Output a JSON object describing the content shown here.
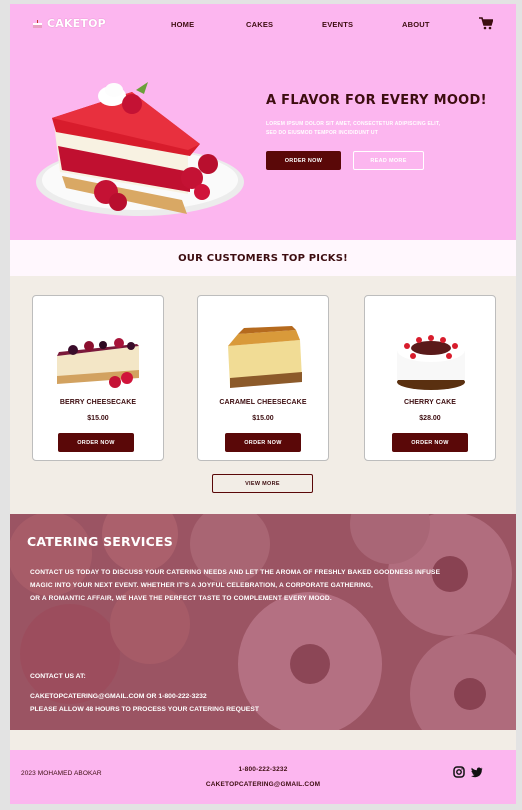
{
  "brand": {
    "name": "CAKETOP"
  },
  "nav": {
    "links": [
      "HOME",
      "CAKES",
      "EVENTS",
      "ABOUT"
    ],
    "cart_icon": "cart-icon"
  },
  "hero": {
    "title": "A FLAVOR FOR EVERY MOOD!",
    "text": "LOREM IPSUM DOLOR SIT AMET, CONSECTETUR ADIPISCING ELIT, SED DO EIUSMOD TEMPOR INCIDIDUNT UT",
    "order_label": "ORDER NOW",
    "read_more_label": "READ MORE"
  },
  "picks": {
    "title": "OUR CUSTOMERS TOP PICKS!",
    "items": [
      {
        "name": "BERRY CHEESECAKE",
        "price": "$15.00",
        "button": "ORDER NOW"
      },
      {
        "name": "CARAMEL CHEESECAKE",
        "price": "$15.00",
        "button": "ORDER NOW"
      },
      {
        "name": "CHERRY CAKE",
        "price": "$28.00",
        "button": "ORDER NOW"
      }
    ],
    "view_more_label": "VIEW MORE"
  },
  "catering": {
    "title": "CATERING SERVICES",
    "lines": [
      "CONTACT US TODAY TO DISCUSS YOUR CATERING NEEDS AND LET THE AROMA OF FRESHLY BAKED GOODNESS INFUSE",
      "MAGIC INTO YOUR NEXT EVENT. WHETHER IT'S A JOYFUL CELEBRATION, A CORPORATE GATHERING,",
      "OR A ROMANTIC AFFAIR, WE HAVE THE PERFECT TASTE TO COMPLEMENT EVERY MOOD."
    ],
    "contact_label": "CONTACT US AT:",
    "contact_line": "CAKETOPCATERING@GMAIL.COM OR 1-800-222-3232",
    "notice": "PLEASE ALLOW 48 HOURS TO PROCESS YOUR CATERING REQUEST"
  },
  "footer": {
    "copyright": "2023 MOHAMED ABOKAR",
    "phone": "1-800-222-3232",
    "email": "CAKETOPCATERING@GMAIL.COM",
    "social_icons": [
      "instagram-icon",
      "twitter-icon"
    ]
  },
  "colors": {
    "pink": "#fcb6ef",
    "maroon": "#5a0808",
    "dark_text": "#3d0d10",
    "cream": "#f2ede6"
  }
}
